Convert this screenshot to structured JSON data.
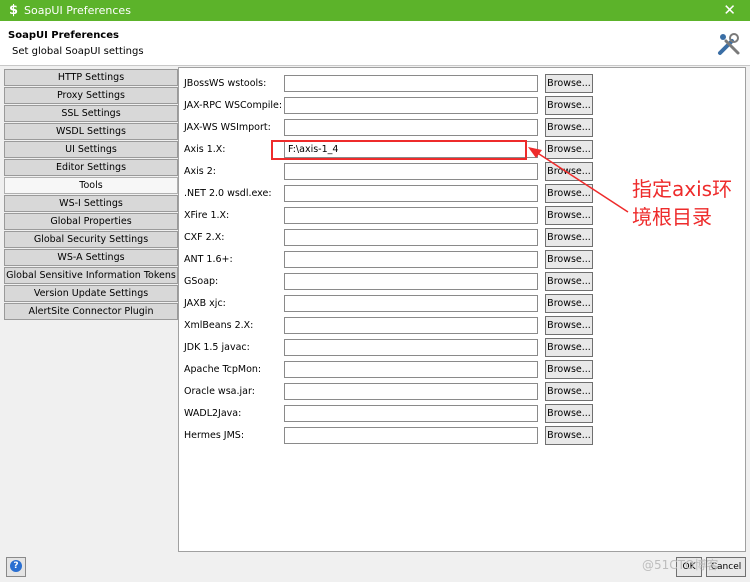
{
  "window": {
    "title": "SoapUI Preferences",
    "close_glyph": "✕"
  },
  "header": {
    "title": "SoapUI Preferences",
    "subtitle": "Set global SoapUI settings",
    "icon": "tools-icon"
  },
  "tabs": [
    "HTTP Settings",
    "Proxy Settings",
    "SSL Settings",
    "WSDL Settings",
    "UI Settings",
    "Editor Settings",
    "Tools",
    "WS-I Settings",
    "Global Properties",
    "Global Security Settings",
    "WS-A Settings",
    "Global Sensitive Information Tokens",
    "Version Update Settings",
    "AlertSite Connector Plugin"
  ],
  "active_tab": "Tools",
  "tools": {
    "browse_label": "Browse...",
    "rows": [
      {
        "label": "JBossWS wstools:",
        "value": ""
      },
      {
        "label": "JAX-RPC WSCompile:",
        "value": ""
      },
      {
        "label": "JAX-WS WSImport:",
        "value": ""
      },
      {
        "label": "Axis 1.X:",
        "value": "F:\\axis-1_4"
      },
      {
        "label": "Axis 2:",
        "value": ""
      },
      {
        "label": ".NET 2.0 wsdl.exe:",
        "value": ""
      },
      {
        "label": "XFire 1.X:",
        "value": ""
      },
      {
        "label": "CXF 2.X:",
        "value": ""
      },
      {
        "label": "ANT 1.6+:",
        "value": ""
      },
      {
        "label": "GSoap:",
        "value": ""
      },
      {
        "label": "JAXB xjc:",
        "value": ""
      },
      {
        "label": "XmlBeans 2.X:",
        "value": ""
      },
      {
        "label": "JDK 1.5 javac:",
        "value": ""
      },
      {
        "label": "Apache TcpMon:",
        "value": ""
      },
      {
        "label": "Oracle wsa.jar:",
        "value": ""
      },
      {
        "label": "WADL2Java:",
        "value": ""
      },
      {
        "label": "Hermes JMS:",
        "value": ""
      }
    ]
  },
  "annotation": {
    "line1": "指定axis环",
    "line2": "境根目录",
    "color": "#ee2b2b"
  },
  "footer": {
    "help_glyph": "?",
    "ok_label": "OK",
    "cancel_label": "Cancel",
    "watermark": "@51CTO博客"
  },
  "colors": {
    "titlebar": "#5cb32a",
    "annotation": "#ee2b2b"
  }
}
